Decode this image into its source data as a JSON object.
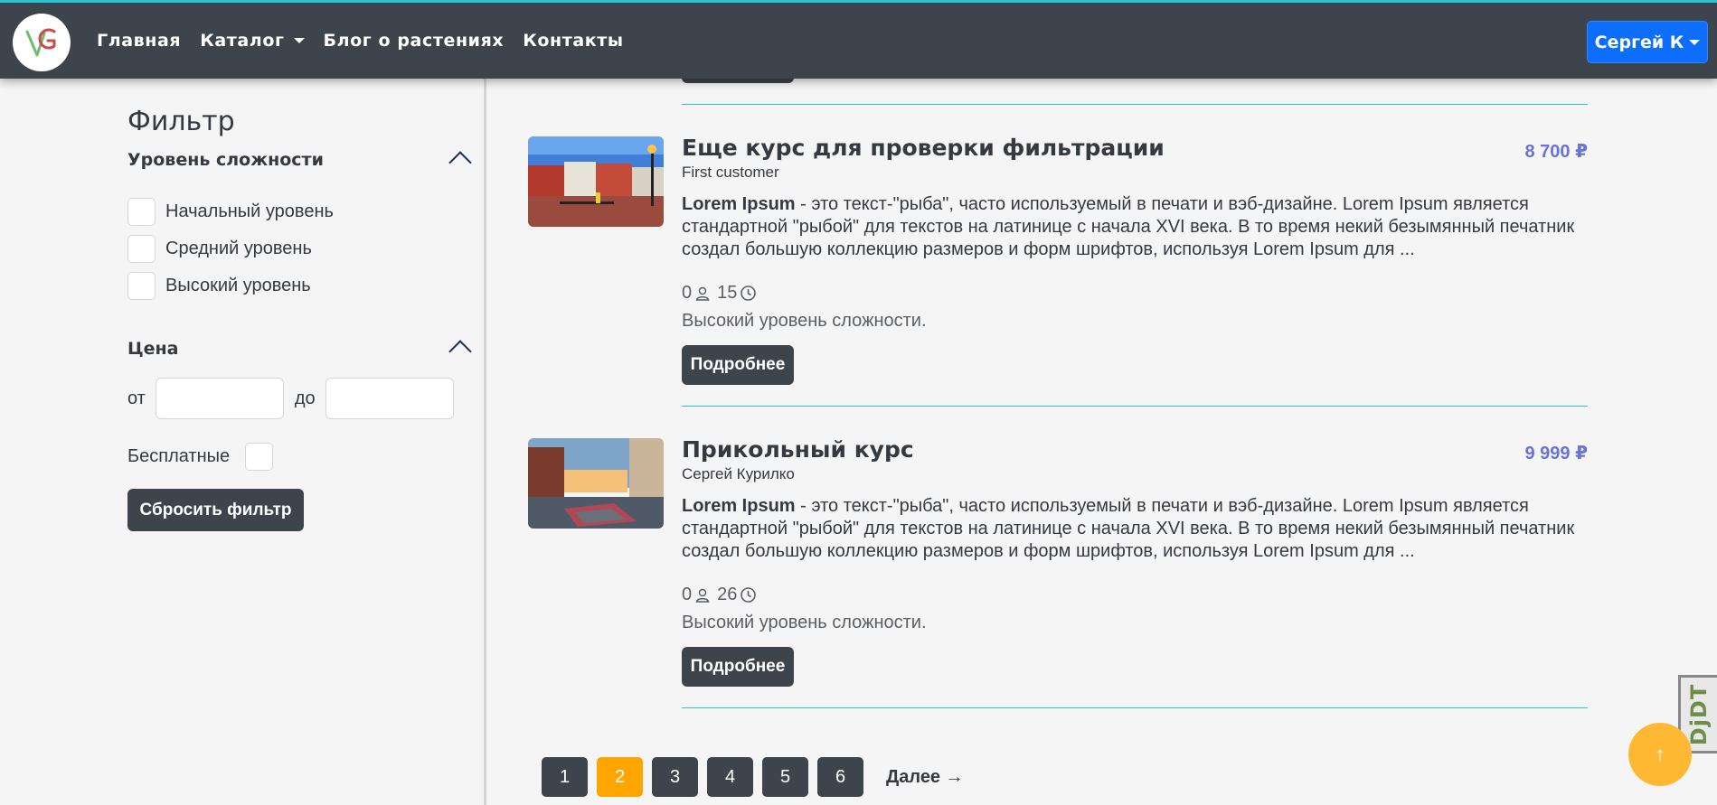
{
  "nav": {
    "links": [
      "Главная",
      "Каталог",
      "Блог о растениях",
      "Контакты"
    ],
    "user": "Сергей К"
  },
  "filter": {
    "title": "Фильтр",
    "difficulty_title": "Уровень сложности",
    "levels": [
      "Начальный уровень",
      "Средний уровень",
      "Высокий уровень"
    ],
    "price_title": "Цена",
    "from": "от",
    "to": "до",
    "free": "Бесплатные",
    "reset": "Сбросить фильтр"
  },
  "courses": [
    {
      "title": "Еще курс для проверки фильтрации",
      "author": "First customer",
      "price": "8 700 ₽",
      "desc_bold": "Lorem Ipsum",
      "desc": " - это текст-\"рыба\", часто используемый в печати и вэб-дизайне. Lorem Ipsum является стандартной \"рыбой\" для текстов на латинице с начала XVI века. В то время некий безымянный печатник создал большую коллекцию размеров и форм шрифтов, используя Lorem Ipsum для ...",
      "students": "0",
      "hours": "15",
      "level": "Высокий уровень сложности.",
      "more": "Подробнее"
    },
    {
      "title": "Прикольный курс",
      "author": "Сергей Курилко",
      "price": "9 999 ₽",
      "desc_bold": "Lorem Ipsum",
      "desc": " - это текст-\"рыба\", часто используемый в печати и вэб-дизайне. Lorem Ipsum является стандартной \"рыбой\" для текстов на латинице с начала XVI века. В то время некий безымянный печатник создал большую коллекцию размеров и форм шрифтов, используя Lorem Ipsum для ...",
      "students": "0",
      "hours": "26",
      "level": "Высокий уровень сложности.",
      "more": "Подробнее"
    }
  ],
  "pagination": {
    "pages": [
      "1",
      "2",
      "3",
      "4",
      "5",
      "6"
    ],
    "active": "2",
    "next": "Далее →"
  },
  "floating": {
    "scroll_top": "↑",
    "debug_toolbar": "DjDT"
  },
  "colors": {
    "navbar": "#3d444b",
    "accent_line": "#2bc4d6",
    "price": "#6a73d8",
    "active_page": "#ffa500",
    "user_button": "#0d6efd"
  }
}
